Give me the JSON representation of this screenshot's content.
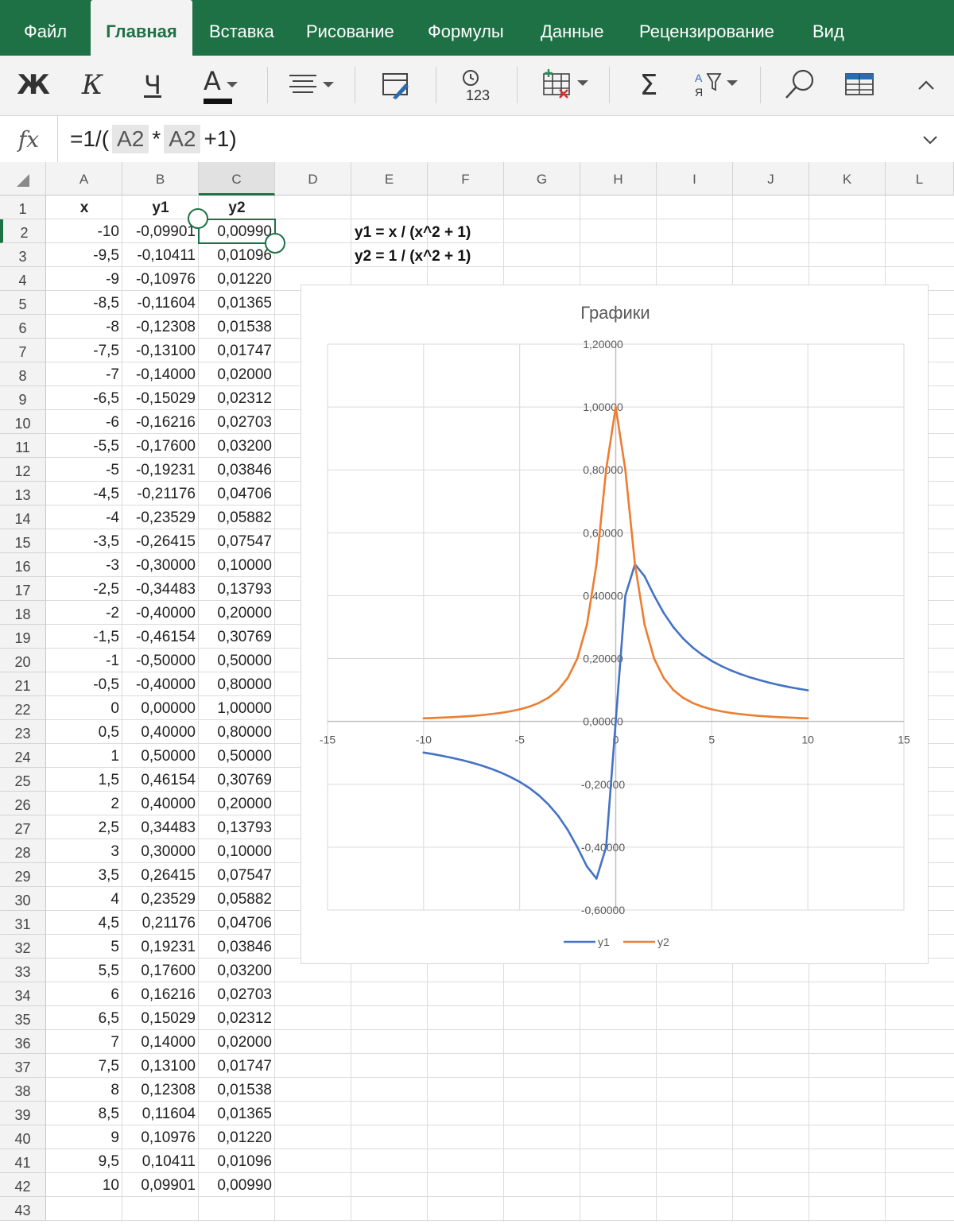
{
  "tabs": [
    "Файл",
    "Главная",
    "Вставка",
    "Рисование",
    "Формулы",
    "Данные",
    "Рецензирование",
    "Вид"
  ],
  "active_tab": 1,
  "toolbar": {
    "bold": "Ж",
    "italic": "К",
    "underline": "Ч",
    "font_color": "A",
    "autosum": "Σ",
    "time_label": "123"
  },
  "formula_bar": {
    "fx": "fx",
    "prefix": "=1/(",
    "ref1": "A2",
    "op": "*",
    "ref2": "A2",
    "suffix": "+1)"
  },
  "columns": [
    "A",
    "B",
    "C",
    "D",
    "E",
    "F",
    "G",
    "H",
    "I",
    "J",
    "K",
    "L"
  ],
  "selected_column": "C",
  "headers": {
    "x": "x",
    "y1": "y1",
    "y2": "y2"
  },
  "rows": [
    [
      "-10",
      "-0,09901",
      "0,00990"
    ],
    [
      "-9,5",
      "-0,10411",
      "0,01096"
    ],
    [
      "-9",
      "-0,10976",
      "0,01220"
    ],
    [
      "-8,5",
      "-0,11604",
      "0,01365"
    ],
    [
      "-8",
      "-0,12308",
      "0,01538"
    ],
    [
      "-7,5",
      "-0,13100",
      "0,01747"
    ],
    [
      "-7",
      "-0,14000",
      "0,02000"
    ],
    [
      "-6,5",
      "-0,15029",
      "0,02312"
    ],
    [
      "-6",
      "-0,16216",
      "0,02703"
    ],
    [
      "-5,5",
      "-0,17600",
      "0,03200"
    ],
    [
      "-5",
      "-0,19231",
      "0,03846"
    ],
    [
      "-4,5",
      "-0,21176",
      "0,04706"
    ],
    [
      "-4",
      "-0,23529",
      "0,05882"
    ],
    [
      "-3,5",
      "-0,26415",
      "0,07547"
    ],
    [
      "-3",
      "-0,30000",
      "0,10000"
    ],
    [
      "-2,5",
      "-0,34483",
      "0,13793"
    ],
    [
      "-2",
      "-0,40000",
      "0,20000"
    ],
    [
      "-1,5",
      "-0,46154",
      "0,30769"
    ],
    [
      "-1",
      "-0,50000",
      "0,50000"
    ],
    [
      "-0,5",
      "-0,40000",
      "0,80000"
    ],
    [
      "0",
      "0,00000",
      "1,00000"
    ],
    [
      "0,5",
      "0,40000",
      "0,80000"
    ],
    [
      "1",
      "0,50000",
      "0,50000"
    ],
    [
      "1,5",
      "0,46154",
      "0,30769"
    ],
    [
      "2",
      "0,40000",
      "0,20000"
    ],
    [
      "2,5",
      "0,34483",
      "0,13793"
    ],
    [
      "3",
      "0,30000",
      "0,10000"
    ],
    [
      "3,5",
      "0,26415",
      "0,07547"
    ],
    [
      "4",
      "0,23529",
      "0,05882"
    ],
    [
      "4,5",
      "0,21176",
      "0,04706"
    ],
    [
      "5",
      "0,19231",
      "0,03846"
    ],
    [
      "5,5",
      "0,17600",
      "0,03200"
    ],
    [
      "6",
      "0,16216",
      "0,02703"
    ],
    [
      "6,5",
      "0,15029",
      "0,02312"
    ],
    [
      "7",
      "0,14000",
      "0,02000"
    ],
    [
      "7,5",
      "0,13100",
      "0,01747"
    ],
    [
      "8",
      "0,12308",
      "0,01538"
    ],
    [
      "8,5",
      "0,11604",
      "0,01365"
    ],
    [
      "9",
      "0,10976",
      "0,01220"
    ],
    [
      "9,5",
      "0,10411",
      "0,01096"
    ],
    [
      "10",
      "0,09901",
      "0,00990"
    ]
  ],
  "notes": [
    "y1 = x / (x^2 + 1)",
    "y2 = 1 / (x^2 + 1)"
  ],
  "chart_data": {
    "type": "scatter",
    "title": "Графики",
    "xlim": [
      -15,
      15
    ],
    "ylim": [
      -0.6,
      1.2
    ],
    "x_ticks": [
      "-15",
      "-10",
      "-5",
      "0",
      "5",
      "10",
      "15"
    ],
    "y_ticks": [
      "1,20000",
      "1,00000",
      "0,80000",
      "0,60000",
      "0,40000",
      "0,20000",
      "0,00000",
      "-0,20000",
      "-0,40000",
      "-0,60000"
    ],
    "x": [
      -10,
      -9.5,
      -9,
      -8.5,
      -8,
      -7.5,
      -7,
      -6.5,
      -6,
      -5.5,
      -5,
      -4.5,
      -4,
      -3.5,
      -3,
      -2.5,
      -2,
      -1.5,
      -1,
      -0.5,
      0,
      0.5,
      1,
      1.5,
      2,
      2.5,
      3,
      3.5,
      4,
      4.5,
      5,
      5.5,
      6,
      6.5,
      7,
      7.5,
      8,
      8.5,
      9,
      9.5,
      10
    ],
    "series": [
      {
        "name": "y1",
        "color": "#4472c4",
        "values": [
          -0.09901,
          -0.10411,
          -0.10976,
          -0.11604,
          -0.12308,
          -0.131,
          -0.14,
          -0.15029,
          -0.16216,
          -0.176,
          -0.19231,
          -0.21176,
          -0.23529,
          -0.26415,
          -0.3,
          -0.34483,
          -0.4,
          -0.46154,
          -0.5,
          -0.4,
          0.0,
          0.4,
          0.5,
          0.46154,
          0.4,
          0.34483,
          0.3,
          0.26415,
          0.23529,
          0.21176,
          0.19231,
          0.176,
          0.16216,
          0.15029,
          0.14,
          0.131,
          0.12308,
          0.11604,
          0.10976,
          0.10411,
          0.09901
        ]
      },
      {
        "name": "y2",
        "color": "#ed7d31",
        "values": [
          0.0099,
          0.01096,
          0.0122,
          0.01365,
          0.01538,
          0.01747,
          0.02,
          0.02312,
          0.02703,
          0.032,
          0.03846,
          0.04706,
          0.05882,
          0.07547,
          0.1,
          0.13793,
          0.2,
          0.30769,
          0.5,
          0.8,
          1.0,
          0.8,
          0.5,
          0.30769,
          0.2,
          0.13793,
          0.1,
          0.07547,
          0.05882,
          0.04706,
          0.03846,
          0.032,
          0.02703,
          0.02312,
          0.02,
          0.01747,
          0.01538,
          0.01365,
          0.0122,
          0.01096,
          0.0099
        ]
      }
    ],
    "grid": true,
    "legend": "bottom"
  }
}
